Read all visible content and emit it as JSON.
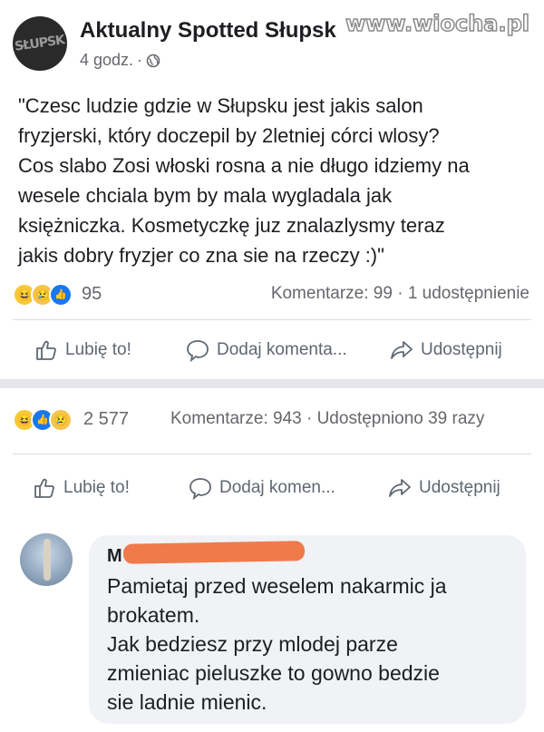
{
  "watermark": "www.wiocha.pl",
  "post": {
    "page_name": "Aktualny Spotted Słupsk",
    "avatar_text": "SŁUPSK",
    "time": "4 godz.",
    "separator": "·",
    "text": "\"Czesc ludzie gdzie w Słupsku jest jakis salon\nfryzjerski, który doczepil by 2letniej córci wlosy?\nCos slabo Zosi włoski rosna a nie długo idziemy na\nwesele chciala bym by mala wygladala jak\nksiężniczka. Kosmetyczkę juz znalazlysmy teraz\njakis dobry fryzjer co zna sie na rzeczy :)\""
  },
  "reactions_1": {
    "count": "95",
    "stats": "Komentarze: 99 · 1 udostępnienie"
  },
  "actions_1": {
    "like": "Lubię to!",
    "comment": "Dodaj komenta...",
    "share": "Udostępnij"
  },
  "reactions_2": {
    "count": "2 577",
    "stats": "Komentarze: 943 · Udostępniono 39 razy"
  },
  "actions_2": {
    "like": "Lubię to!",
    "comment": "Dodaj komen...",
    "share": "Udostępnij"
  },
  "comment": {
    "author_initial": "M",
    "text": "Pamietaj przed weselem nakarmic ja\nbrokatem.\nJak bedziesz przy mlodej parze\nzmieniac pieluszke to gowno bedzie\nsie ladnie mienic."
  },
  "icons": {
    "globe": "globe-icon",
    "like": "thumbs-up-icon",
    "comment": "speech-bubble-icon",
    "share": "share-arrow-icon"
  },
  "colors": {
    "text": "#1c1e21",
    "secondary": "#65676b",
    "like_blue": "#1877f2",
    "bubble": "#f0f2f5",
    "redaction": "#f07a4a"
  }
}
